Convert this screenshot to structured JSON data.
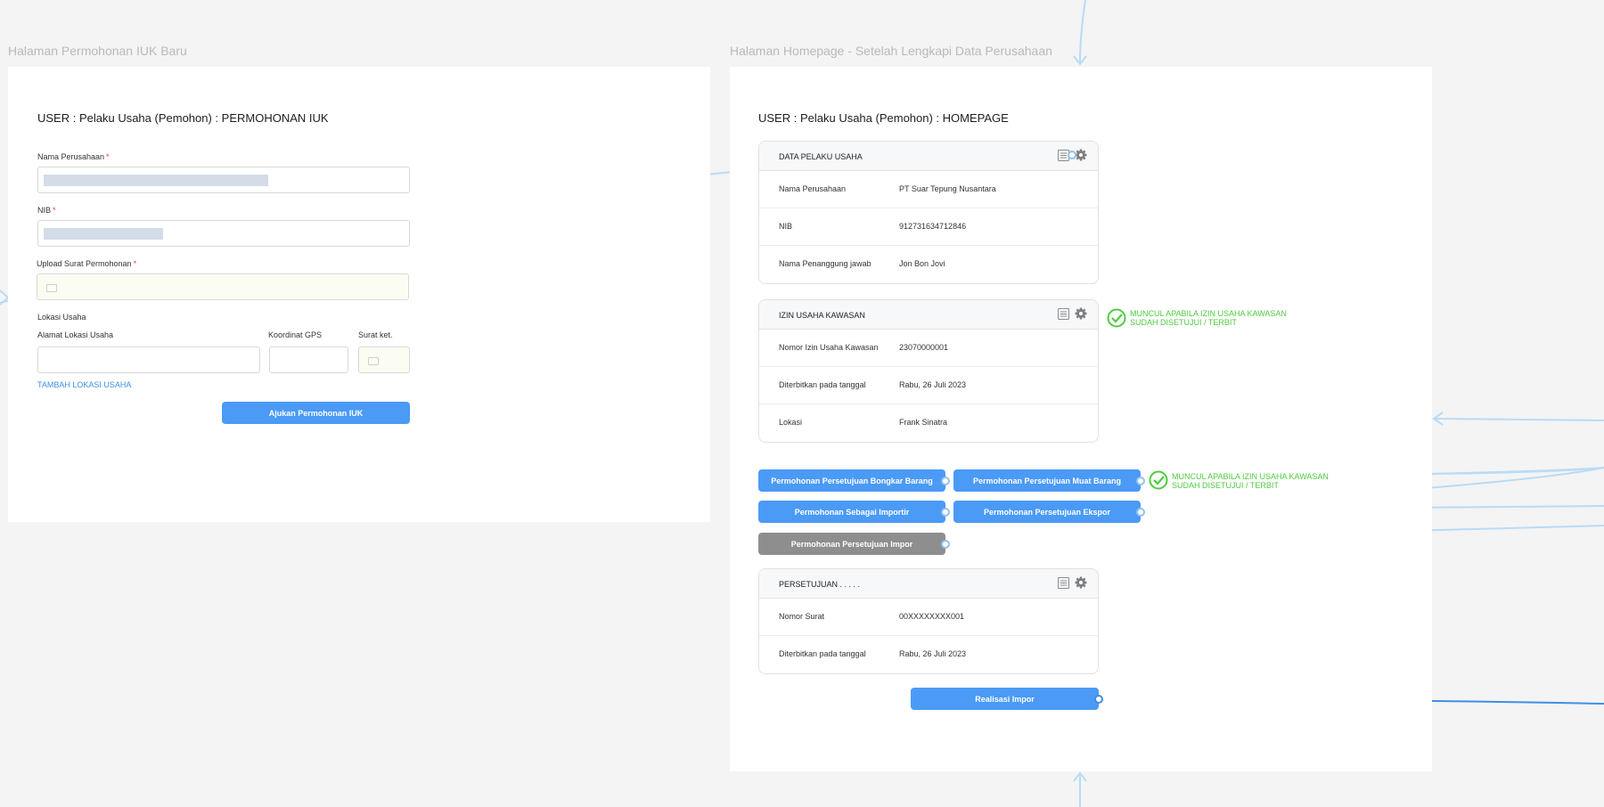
{
  "left_frame": {
    "frame_title": "Halaman Permohonan IUK Baru",
    "heading": "USER : Pelaku Usaha (Pemohon) : PERMOHONAN IUK",
    "fields": {
      "company_name_label": "Nama Perusahaan",
      "nib_label": "NIB",
      "upload_label": "Upload Surat Permohonan",
      "required_mark": "*"
    },
    "location": {
      "section_label": "Lokasi Usaha",
      "address_label": "Alamat Lokasi Usaha",
      "gps_label": "Koordinat GPS",
      "letter_label": "Surat ket.",
      "add_link": "TAMBAH LOKASI USAHA"
    },
    "submit_button": "Ajukan Permohonan IUK"
  },
  "right_frame": {
    "frame_title": "Halaman Homepage - Setelah Lengkapi Data Perusahaan",
    "heading": "USER : Pelaku Usaha (Pemohon) : HOMEPAGE",
    "business_card": {
      "title": "DATA PELAKU USAHA",
      "rows": [
        {
          "key": "Nama Perusahaan",
          "value": "PT Suar Tepung Nusantara"
        },
        {
          "key": "NIB",
          "value": "912731634712846"
        },
        {
          "key": "Nama Penanggung jawab",
          "value": "Jon Bon Jovi"
        }
      ]
    },
    "permit_card": {
      "title": "IZIN USAHA KAWASAN",
      "rows": [
        {
          "key": "Nomor Izin Usaha Kawasan",
          "value": "23070000001"
        },
        {
          "key": "Diterbitkan pada tanggal",
          "value": "Rabu, 26 Juli 2023"
        },
        {
          "key": "Lokasi",
          "value": "Frank Sinatra"
        }
      ]
    },
    "permit_note": {
      "line1": "MUNCUL APABILA IZIN USAHA KAWASAN",
      "line2": "SUDAH DISETUJUI / TERBIT"
    },
    "actions": {
      "unloading": "Permohonan Persetujuan Bongkar Barang",
      "loading": "Permohonan Persetujuan Muat Barang",
      "importer": "Permohonan Sebagai Importir",
      "export": "Permohonan Persetujuan Ekspor",
      "import": "Permohonan Persetujuan Impor"
    },
    "actions_note": {
      "line1": "MUNCUL APABILA IZIN USAHA KAWASAN",
      "line2": "SUDAH DISETUJUI / TERBIT"
    },
    "approval_card": {
      "title": "PERSETUJUAN . . . . .",
      "rows": [
        {
          "key": "Nomor Surat",
          "value": "00XXXXXXXX001"
        },
        {
          "key": "Diterbitkan pada tanggal",
          "value": "Rabu, 26 Juli 2023"
        }
      ]
    },
    "realization_button": "Realisasi Impor"
  },
  "colors": {
    "primary_button": "#4a9af6",
    "disabled_button": "#8e8e8e",
    "success_note": "#4ecb3f",
    "connector": "#b9dbf7",
    "connector_active": "#3d8fe8"
  },
  "icons": {
    "list": "list-icon",
    "settings": "gear-icon",
    "folder": "folder-icon",
    "check": "check-circle-icon"
  }
}
